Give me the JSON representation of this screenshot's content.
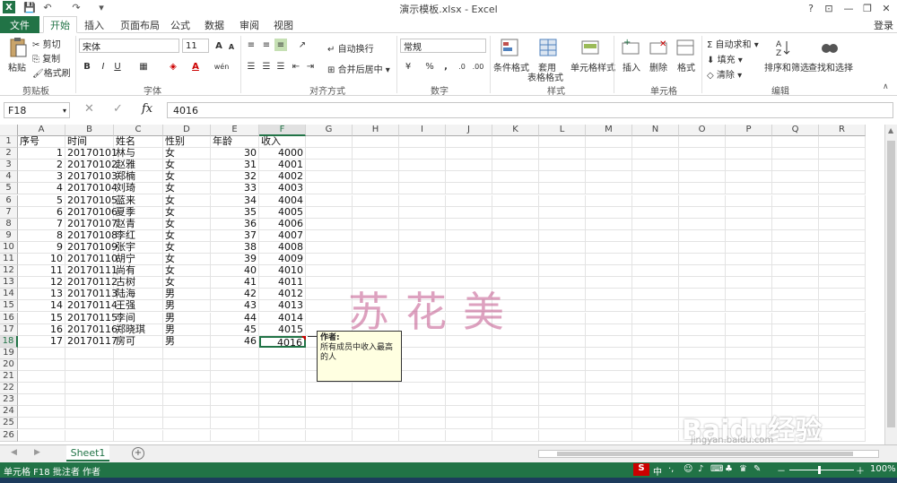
{
  "window": {
    "title": "演示模板.xlsx - Excel",
    "help": "?",
    "ribbon_opts": "⊡",
    "minimize": "—",
    "restore": "❐",
    "close": "✕",
    "login": "登录"
  },
  "qat": {
    "save": "💾",
    "undo": "↶",
    "redo": "↷",
    "more": "▾"
  },
  "tabs": [
    "文件",
    "开始",
    "插入",
    "页面布局",
    "公式",
    "数据",
    "审阅",
    "视图"
  ],
  "ribbon": {
    "clipboard": {
      "paste": "粘贴",
      "cut": "剪切",
      "copy": "复制",
      "painter": "格式刷",
      "label": "剪贴板"
    },
    "font": {
      "name": "宋体",
      "size": "11",
      "bold": "B",
      "italic": "I",
      "underline": "U",
      "grow": "A",
      "shrink": "A",
      "label": "字体",
      "wen": "wén"
    },
    "align": {
      "wrap": "自动换行",
      "merge": "合并后居中",
      "label": "对齐方式"
    },
    "number": {
      "format": "常规",
      "percent": "%",
      "comma": ",",
      "label": "数字"
    },
    "styles": {
      "cond": "条件格式",
      "table1": "套用",
      "table2": "表格格式",
      "cell": "单元格样式",
      "label": "样式"
    },
    "cells": {
      "insert": "插入",
      "delete": "删除",
      "format": "格式",
      "label": "单元格"
    },
    "edit": {
      "autosum": "自动求和",
      "fill": "填充",
      "clear": "清除",
      "sort": "排序和筛选",
      "find": "查找和选择",
      "label": "编辑"
    }
  },
  "formula_bar": {
    "name_box": "F18",
    "value": "4016",
    "fx": "fx"
  },
  "columns": [
    "A",
    "B",
    "C",
    "D",
    "E",
    "F",
    "G",
    "H",
    "I",
    "J",
    "K",
    "L",
    "M",
    "N",
    "O",
    "P",
    "Q",
    "R"
  ],
  "header_row": [
    "序号",
    "时间",
    "姓名",
    "性别",
    "年龄",
    "收入"
  ],
  "rows": [
    [
      "1",
      "20170101",
      "林与",
      "女",
      "30",
      "4000"
    ],
    [
      "2",
      "20170102",
      "赵雅",
      "女",
      "31",
      "4001"
    ],
    [
      "3",
      "20170103",
      "郑楠",
      "女",
      "32",
      "4002"
    ],
    [
      "4",
      "20170104",
      "刘琦",
      "女",
      "33",
      "4003"
    ],
    [
      "5",
      "20170105",
      "蓝来",
      "女",
      "34",
      "4004"
    ],
    [
      "6",
      "20170106",
      "夏季",
      "女",
      "35",
      "4005"
    ],
    [
      "7",
      "20170107",
      "赵青",
      "女",
      "36",
      "4006"
    ],
    [
      "8",
      "20170108",
      "李红",
      "女",
      "37",
      "4007"
    ],
    [
      "9",
      "20170109",
      "张宇",
      "女",
      "38",
      "4008"
    ],
    [
      "10",
      "20170110",
      "胡宁",
      "女",
      "39",
      "4009"
    ],
    [
      "11",
      "20170111",
      "尚有",
      "女",
      "40",
      "4010"
    ],
    [
      "12",
      "20170112",
      "古树",
      "女",
      "41",
      "4011"
    ],
    [
      "13",
      "20170113",
      "陆海",
      "男",
      "42",
      "4012"
    ],
    [
      "14",
      "20170114",
      "王强",
      "男",
      "43",
      "4013"
    ],
    [
      "15",
      "20170115",
      "李间",
      "男",
      "44",
      "4014"
    ],
    [
      "16",
      "20170116",
      "郑晓琪",
      "男",
      "45",
      "4015"
    ],
    [
      "17",
      "20170117",
      "房可",
      "男",
      "46",
      "4016"
    ]
  ],
  "comment": {
    "author": "作者:",
    "text": "所有成员中收入最高的人"
  },
  "watermark": {
    "text": "苏花美",
    "site": "Baidu经验",
    "url": "jingyan.baidu.com"
  },
  "sheet_tab": "Sheet1",
  "add_sheet": "+",
  "status": {
    "left": "单元格 F18 批注者 作者",
    "zoom": "100%",
    "minus": "－",
    "plus": "＋"
  },
  "colors": {
    "accent": "#217346"
  }
}
